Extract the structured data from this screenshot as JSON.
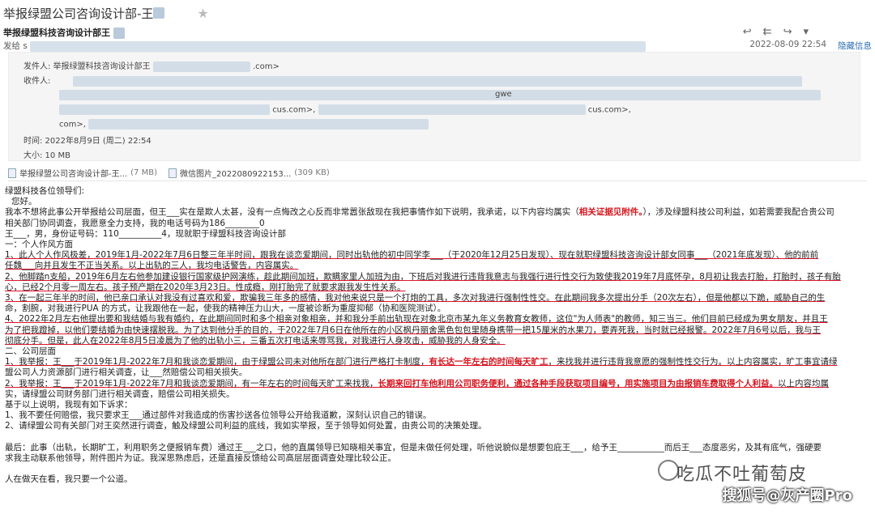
{
  "subject": "举报绿盟公司咨询设计部-王",
  "star_icon": "star-icon",
  "sender_name": "举报绿盟科技咨询设计部王",
  "from_label": "发给 s",
  "toolbar": [
    "reply-icon",
    "reply-all-icon",
    "forward-icon",
    "more-icon"
  ],
  "date": "2022-08-09 22:54",
  "hide_link": "隐藏信息",
  "meta": {
    "sender_label": "发件人: 举报绿盟科技咨询设计部王",
    "sender_email_tail": ".com>",
    "recipient_label": "收件人:",
    "recipients_line3": "gwe",
    "recipients_line4_a": "cus.com>,",
    "recipients_line4_b": "cus.com>,",
    "recipients_line5": "com>,",
    "time": "时间: 2022年8月9日 (周二) 22:54",
    "size": "大小: 10 MB"
  },
  "attachments": [
    {
      "name": "举报绿盟公司咨询设计部-王...",
      "size": "(7 MB)"
    },
    {
      "name": "微信图片_2022080922153...",
      "size": "(309 KB)"
    }
  ],
  "body": [
    "绿盟科技各位领导们:",
    "您好。",
    "我本不想将此事公开举报给公司层面，但王___实在是欺人太甚，没有一点悔改之心反而非常嚣张敌现在我把事情作如下说明，我承诺，以下内容均属实（相关证据见附件。），涉及绿盟科技公司利益，如若需要我配合贵公司",
    "相关部门协同调查，我愿意全力支持，我的电话号码为186________0",
    "王___，男，身份证号码：110__________4，现就职于绿盟科技咨询设计部",
    "一：个人作风方面",
    "1、此人个人作风极差，2019年1月-2022年7月6日整三年半时间，跟我在谈恋爱期间，同时出轨他的初中同学李___（于2020年12月25日发现）、现在就职绿盟科技咨询设计部女同事___（2021年底发现）、他的前前",
    "任魏___向并且发生不正当关系。以上出轨的三人，我均电话警告，内容属实。",
    "2、他脚踏n支船，2019年6月左右他参加建设银行国家级护网演练，趁此期间加班，欺瞒家里人加班为由，下班后对我进行违背我意志与我强行进行性交行为致使我2019年7月底怀孕，8月初让我去打胎，打胎时，孩子有胎",
    "心，已经2个月零一周左右。孩子预产期在2020年3月23日。性成瘾，刚打胎完了就要求跟我发生性关系。",
    "3、在一起三年半的时间，他已亲口承认对我没有过喜欢和爱，欺骗我三年多的感情，我对他来说只是一个打炮的工具，多次对我进行强制性性交。在此期间我多次提出分手（20次左右），但是他都以下跪，威胁自己的生",
    "命，割腕，对我进行PUA 的方式，让我跟他在一起，使我的精神压力山大，一度被诊断为重度抑郁（协和医院测试）。",
    "4、2022年2月左右他提出要和我结婚与我有婚约，在此期间同时和多个相亲对象相亲，并和我分手前出轨现在对象北京市某九年义务教育女教师，这位\"为人师表\"的教师，知三当三。他们目前已经成为男女朋友，并且王",
    "为了把我蹬掉，以他们要结婚为由快速摆脱我。为了达到他分手的目的，于2022年7月6日在他所在的小区枫丹丽舍黑色包包里随身携带一把15厘米的水果刀，要弄死我，当时就已经报警。2022年7月6号以后，我与王",
    "彻底分手。但是，此人在2022年8月5日凌晨为了他的出轨小三，三番五次打电话来辱骂我，对我进行人身攻击，威胁我的人身安全。",
    "二、公司层面",
    "1、我举报：王___于2019年1月-2022年7月和我谈恋爱期间，由于绿盟公司未对他所在部门进行严格打卡制度，有长达一年左右的时间每天旷工，来找我并进行违背我意愿的强制性性交行为。以上内容属实，旷工事宜请绿",
    "盟公司人力资源部门进行相关调查，让___然赔偿公司相关损失。",
    "2、我举报：王___于2019年1月-2022年7月和我谈恋爱期间，有一年左右的时间每天旷工来找我，长期来回打车他利用公司职务便利，通过各种手段获取项目编号，用实施项目为由报销车费取得个人利益。以上内容均属",
    "实，请绿盟公司财务部门进行相关调查，赔偿公司相关损失。",
    "基于以上说明，我现有如下诉求：",
    "1、我不要任何赔偿，我只要求王___通过部件对我造成的伤害抄送各位领导公开给我道歉，深刻认识自己的错误。",
    "2、请绿盟公司有关部门对王奕然进行调查，触及绿盟公司利益的底线，我如实举报，至于领导如何处置，由贵公司的决策处理。",
    "",
    "最后：此事（出轨，长期旷工，利用职务之便报销车费）通过王___之口，他的直属领导已知晓相关事宜，但是未做任何处理，听他说貌似是想要包庇王___，给予王___________而后王___态度恶劣，及其有底气，强硬要",
    "求我主动联系他领导，附件图片为证。我深思熟虑后，还是直接反馈给公司高层层面调查处理比较公正。",
    "",
    "人在做天在看，我只要一个公道。"
  ],
  "watermark_top": "吃瓜不吐葡萄皮",
  "watermark_bottom": "搜狐号@灰产圈Pro",
  "colors": {
    "accent_red": "#d4141c",
    "link_blue": "#2b6cb0"
  }
}
